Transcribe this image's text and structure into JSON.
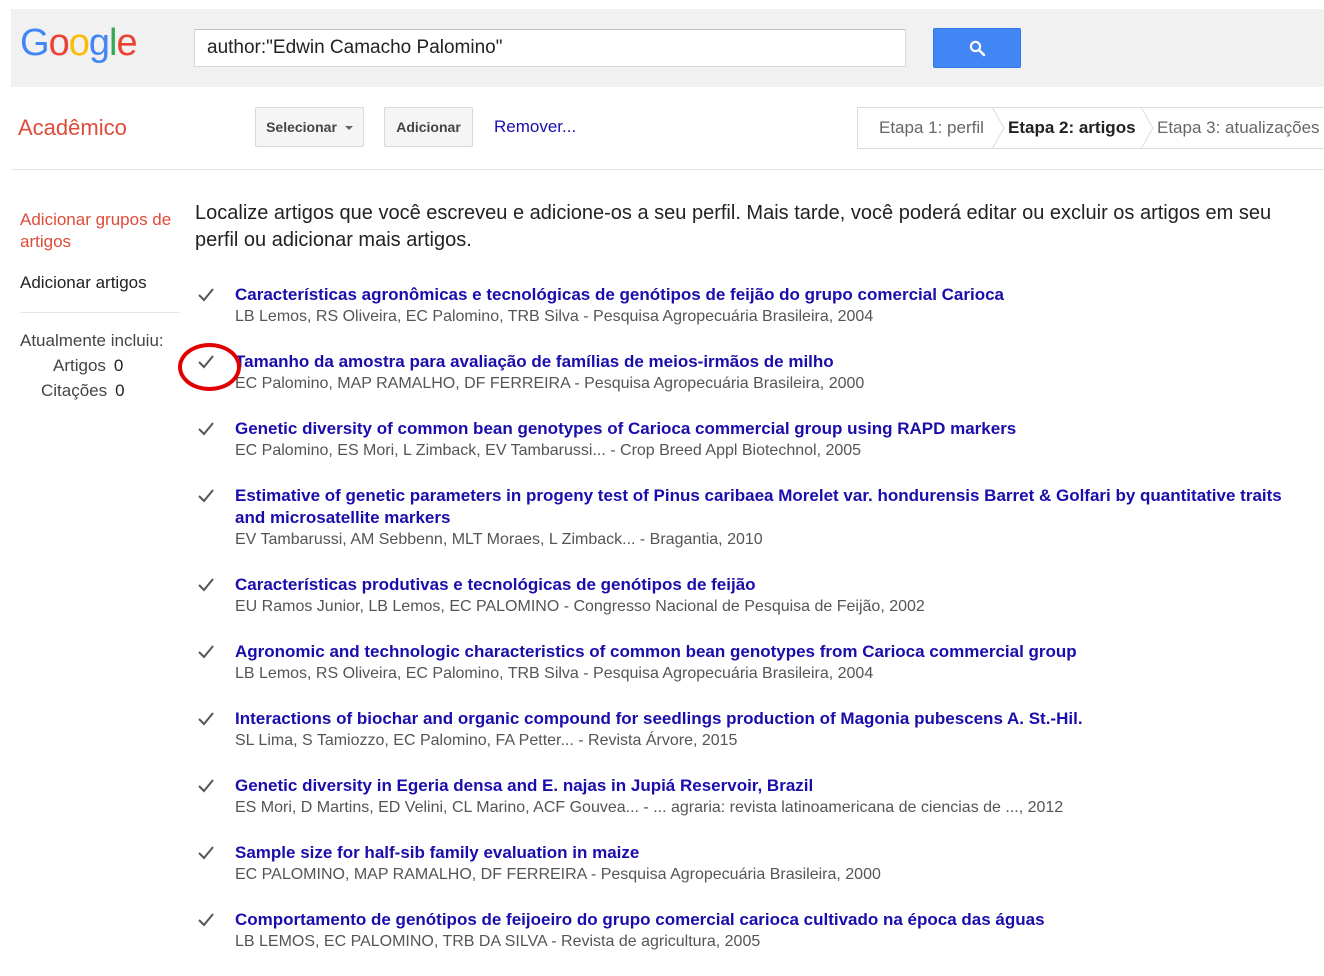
{
  "colors": {
    "accent": "#4285f4",
    "brand": "#dd4b39",
    "link": "#1a0dab"
  },
  "logo": {
    "text": "Google"
  },
  "search": {
    "value": "author:\"Edwin Camacho Palomino\"",
    "icon": "search-icon"
  },
  "header": {
    "brand": "Acadêmico"
  },
  "toolbar": {
    "select_label": "Selecionar",
    "add_label": "Adicionar",
    "remove_label": "Remover..."
  },
  "steps": {
    "step1": "Etapa 1: perfil",
    "step2": "Etapa 2: artigos",
    "step3": "Etapa 3: atualizações"
  },
  "sidebar": {
    "add_groups": "Adicionar grupos de artigos",
    "add_articles": "Adicionar artigos",
    "includes_label": "Atualmente incluiu:",
    "articles_label": "Artigos",
    "articles_count": "0",
    "citations_label": "Citações",
    "citations_count": "0"
  },
  "intro": "Localize artigos que você escreveu e adicione-os a seu perfil. Mais tarde, você poderá editar ou excluir os artigos em seu perfil ou adicionar mais artigos.",
  "articles": [
    {
      "title": "Características agronômicas e tecnológicas de genótipos de feijão do grupo comercial Carioca",
      "meta": "LB Lemos, RS Oliveira, EC Palomino, TRB Silva - Pesquisa Agropecuária Brasileira, 2004"
    },
    {
      "title": "Tamanho da amostra para avaliação de famílias de meios-irmãos de milho",
      "meta": "EC Palomino, MAP RAMALHO, DF FERREIRA - Pesquisa Agropecuária Brasileira, 2000"
    },
    {
      "title": "Genetic diversity of common bean genotypes of Carioca commercial group using RAPD markers",
      "meta": "EC Palomino, ES Mori, L Zimback, EV Tambarussi... - Crop Breed Appl Biotechnol, 2005"
    },
    {
      "title": "Estimative of genetic parameters in progeny test of Pinus caribaea Morelet var. hondurensis Barret & Golfari by quantitative traits and microsatellite markers",
      "meta": "EV Tambarussi, AM Sebbenn, MLT Moraes, L Zimback... - Bragantia, 2010"
    },
    {
      "title": "Características produtivas e tecnológicas de genótipos de feijão",
      "meta": "EU Ramos Junior, LB Lemos, EC PALOMINO - Congresso Nacional de Pesquisa de Feijão, 2002"
    },
    {
      "title": "Agronomic and technologic characteristics of common bean genotypes from Carioca commercial group",
      "meta": "LB Lemos, RS Oliveira, EC Palomino, TRB Silva - Pesquisa Agropecuária Brasileira, 2004"
    },
    {
      "title": "Interactions of biochar and organic compound for seedlings production of Magonia pubescens A. St.-Hil.",
      "meta": "SL Lima, S Tamiozzo, EC Palomino, FA Petter... - Revista Árvore, 2015"
    },
    {
      "title": "Genetic diversity in Egeria densa and E. najas in Jupiá Reservoir, Brazil",
      "meta": "ES Mori, D Martins, ED Velini, CL Marino, ACF Gouvea... - ... agraria: revista latinoamericana de ciencias de ..., 2012"
    },
    {
      "title": "Sample size for half-sib family evaluation in maize",
      "meta": "EC PALOMINO, MAP RAMALHO, DF FERREIRA - Pesquisa Agropecuária Brasileira, 2000"
    },
    {
      "title": "Comportamento de genótipos de feijoeiro do grupo comercial carioca cultivado na época das águas",
      "meta": "LB LEMOS, EC PALOMINO, TRB DA SILVA - Revista de agricultura, 2005"
    }
  ]
}
